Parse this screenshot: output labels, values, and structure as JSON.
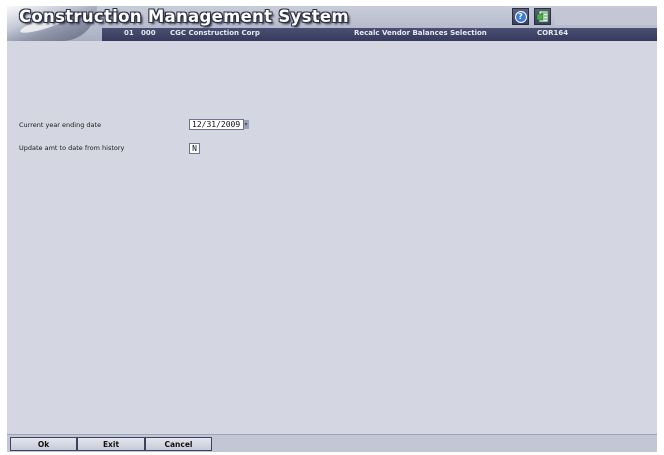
{
  "header": {
    "app_title": "Construction Management System",
    "company_no": "01",
    "division": "000",
    "company_name": "CGC Construction Corp",
    "screen_title": "Recalc Vendor Balances Selection",
    "program_id": "COR164",
    "help_icon": "help-icon",
    "reports_icon": "reports-icon"
  },
  "form": {
    "ending_date_label": "Current year ending date",
    "ending_date_value": "12/31/2009",
    "update_label": "Update amt to date from history",
    "update_value": "N"
  },
  "buttons": {
    "ok": "Ok",
    "exit": "Exit",
    "cancel": "Cancel"
  },
  "colors": {
    "background": "#d4d6e2",
    "info_bar": "#3f4466"
  }
}
